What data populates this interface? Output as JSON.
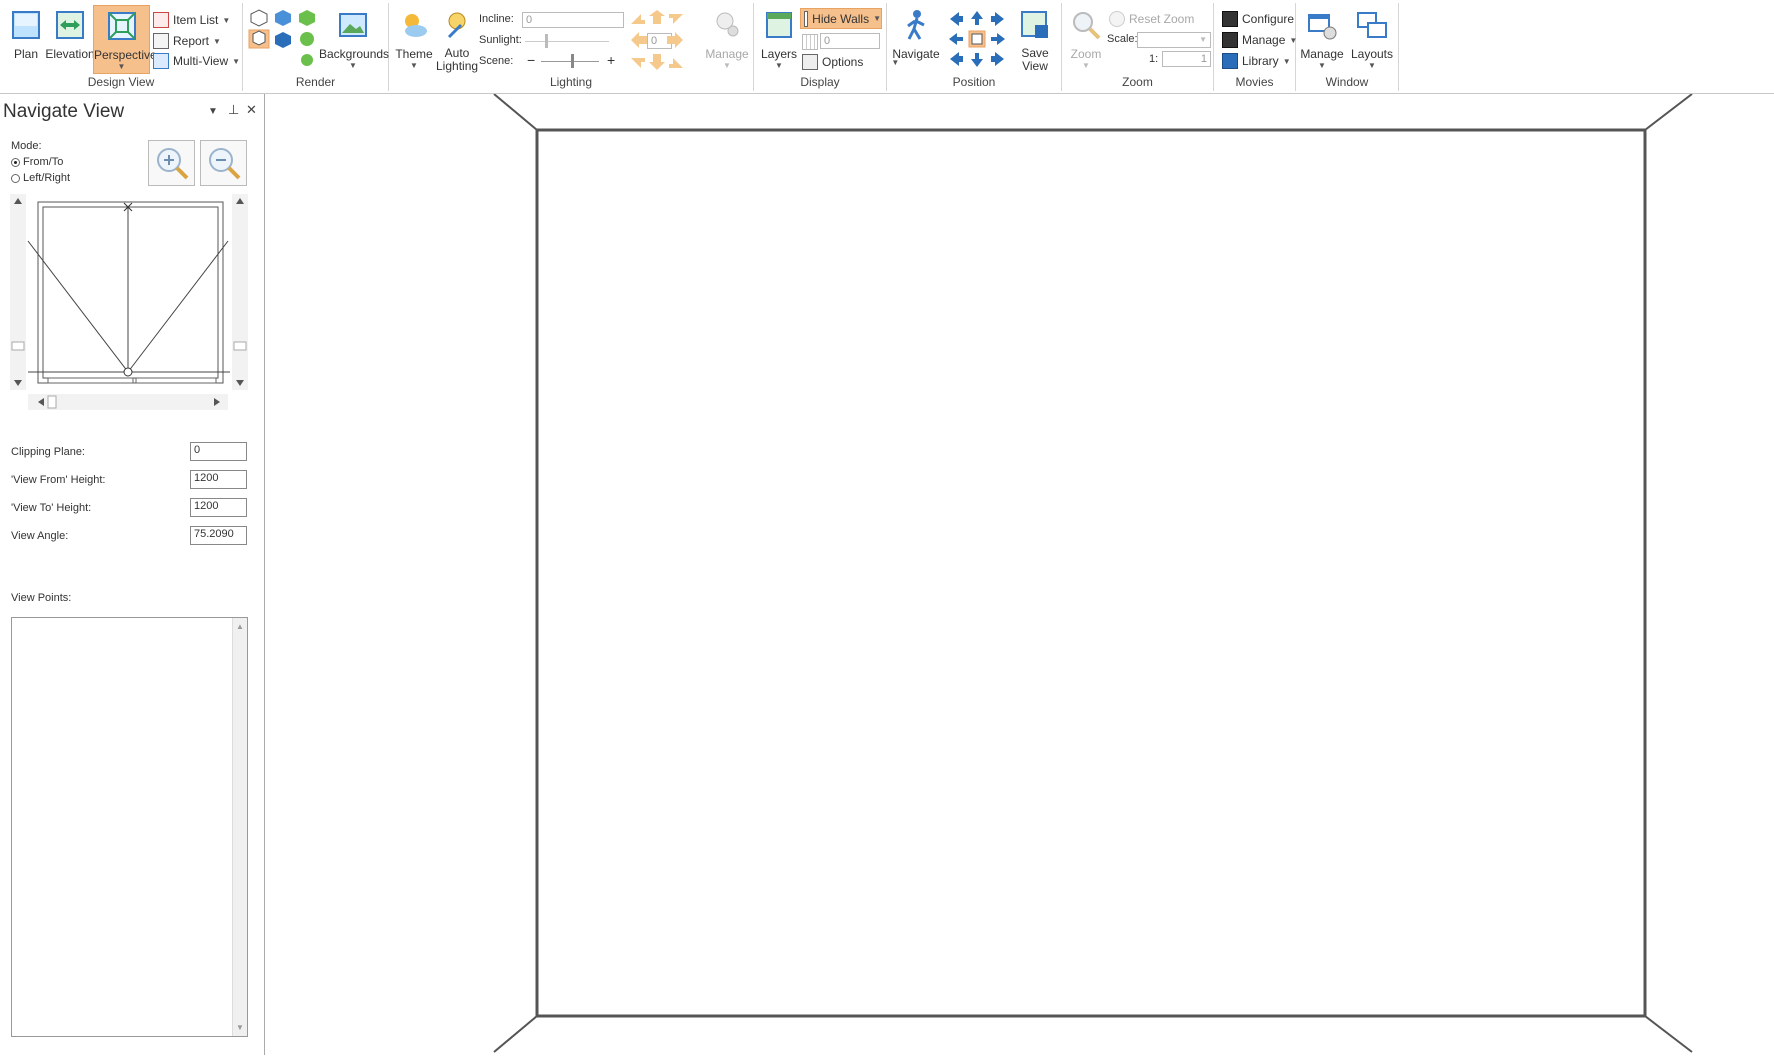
{
  "ribbon": {
    "design_view": {
      "title": "Design View",
      "plan": "Plan",
      "elevation": "Elevation",
      "perspective": "Perspective",
      "item_list": "Item List",
      "report": "Report",
      "multi_view": "Multi-View"
    },
    "render": {
      "title": "Render",
      "backgrounds": "Backgrounds"
    },
    "lighting": {
      "title": "Lighting",
      "theme": "Theme",
      "auto_lighting_1": "Auto",
      "auto_lighting_2": "Lighting",
      "incline_label": "Incline:",
      "incline_value": "0",
      "sunlight_label": "Sunlight:",
      "sunlight_value": "0",
      "scene_label": "Scene:",
      "manage": "Manage"
    },
    "display": {
      "title": "Display",
      "layers": "Layers",
      "hide_walls": "Hide Walls",
      "grid_value": "0",
      "options": "Options"
    },
    "position": {
      "title": "Position",
      "navigate": "Navigate",
      "save_view_1": "Save",
      "save_view_2": "View"
    },
    "zoom": {
      "title": "Zoom",
      "zoom": "Zoom",
      "reset_zoom": "Reset Zoom",
      "scale_label": "Scale:",
      "ratio_label": "1:",
      "ratio_value": "1"
    },
    "movies": {
      "title": "Movies",
      "configure": "Configure",
      "manage": "Manage",
      "library": "Library"
    },
    "window": {
      "title": "Window",
      "manage": "Manage",
      "layouts": "Layouts"
    }
  },
  "navigate_pane": {
    "title": "Navigate View",
    "mode_label": "Mode:",
    "mode_from_to": "From/To",
    "mode_left_right": "Left/Right",
    "clipping_plane_label": "Clipping Plane:",
    "clipping_plane_value": "0",
    "view_from_height_label": "'View From' Height:",
    "view_from_height_value": "1200",
    "view_to_height_label": "'View To' Height:",
    "view_to_height_value": "1200",
    "view_angle_label": "View Angle:",
    "view_angle_value": "75.2090",
    "view_points_label": "View Points:"
  },
  "colors": {
    "accent": "#f6c08d",
    "accent_border": "#e8a262",
    "top_accent": "#f0a35a"
  }
}
